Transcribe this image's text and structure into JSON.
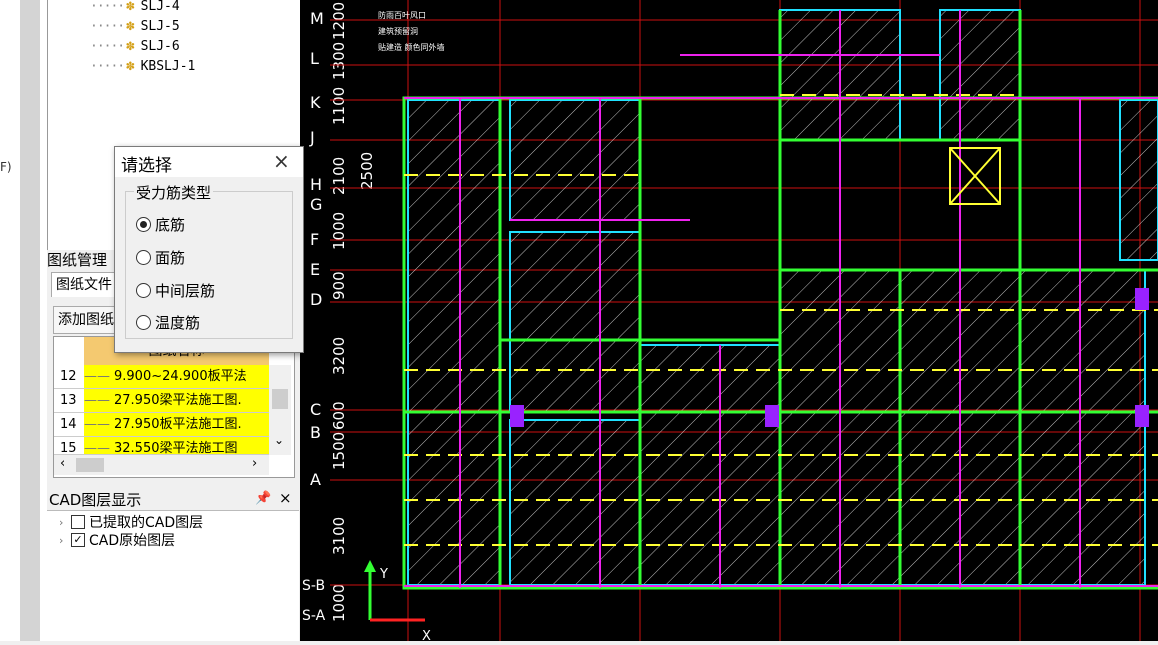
{
  "left_fragment": "F)",
  "tree": {
    "items": [
      {
        "label": "SLJ-4"
      },
      {
        "label": "SLJ-5"
      },
      {
        "label": "SLJ-6"
      },
      {
        "label": "KBSLJ-1"
      }
    ]
  },
  "drawings": {
    "title": "图纸管理",
    "tab_files": "图纸文件",
    "add_button": "添加图纸",
    "column_header": "图纸名称",
    "rows": [
      {
        "num": "12",
        "name": "9.900~24.900板平法"
      },
      {
        "num": "13",
        "name": "27.950梁平法施工图."
      },
      {
        "num": "14",
        "name": "27.950板平法施工图."
      },
      {
        "num": "15",
        "name": "32.550梁平法施工图"
      }
    ]
  },
  "cad_layers": {
    "title": "CAD图层显示",
    "pin": "ᵖ",
    "close": "×",
    "items": [
      {
        "label": "已提取的CAD图层",
        "checked": false
      },
      {
        "label": "CAD原始图层",
        "checked": true
      }
    ]
  },
  "dialog": {
    "title": "请选择",
    "close": "×",
    "group_label": "受力筋类型",
    "options": [
      {
        "label": "底筋",
        "selected": true
      },
      {
        "label": "面筋",
        "selected": false
      },
      {
        "label": "中间层筋",
        "selected": false
      },
      {
        "label": "温度筋",
        "selected": false
      }
    ]
  },
  "cad": {
    "grid_letters": [
      "M",
      "L",
      "K",
      "J",
      "H",
      "G",
      "F",
      "E",
      "D",
      "C",
      "B",
      "A",
      "S-B",
      "S-A"
    ],
    "dimensions": [
      "1200",
      "1300",
      "1100",
      "2100",
      "2500",
      "900",
      "1000",
      "3200",
      "1500",
      "600",
      "3100",
      "1000"
    ],
    "notes": [
      "防雨百叶风口",
      "建筑预留洞",
      "贴建造 颜色同外墙"
    ],
    "axis_y": "Y",
    "axis_x": "X"
  }
}
